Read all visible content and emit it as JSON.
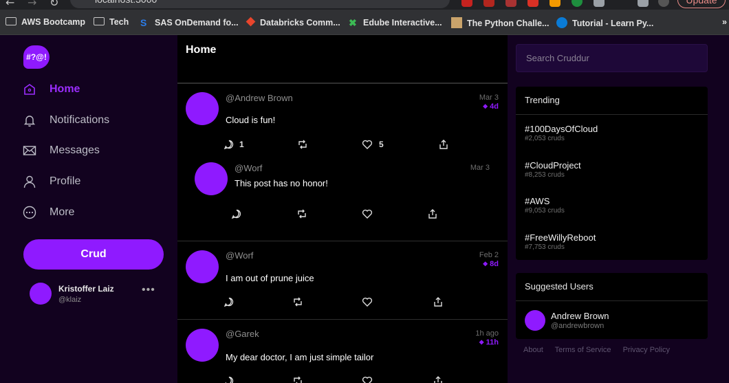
{
  "browser": {
    "url": "localhost:3000",
    "update_label": "Update",
    "bookmarks": [
      {
        "label": "AWS Bootcamp",
        "icon": "folder-icon"
      },
      {
        "label": "Tech",
        "icon": "folder-icon"
      },
      {
        "label": "SAS OnDemand fo...",
        "icon": "sas-icon"
      },
      {
        "label": "Databricks Comm...",
        "icon": "databricks-icon"
      },
      {
        "label": "Edube Interactive...",
        "icon": "edube-icon"
      },
      {
        "label": "The Python Challe...",
        "icon": "python-challenge-icon"
      },
      {
        "label": "Tutorial - Learn Py...",
        "icon": "tutorial-icon"
      }
    ],
    "overflow_label": "»"
  },
  "brand": {
    "logo_text": "#?@!",
    "accent": "#8f1aff",
    "sidebar_bg": "#12021f"
  },
  "sidebar": {
    "items": [
      {
        "label": "Home",
        "icon": "home-icon",
        "active": true
      },
      {
        "label": "Notifications",
        "icon": "bell-icon"
      },
      {
        "label": "Messages",
        "icon": "envelope-icon"
      },
      {
        "label": "Profile",
        "icon": "user-icon"
      },
      {
        "label": "More",
        "icon": "ellipsis-circle-icon"
      }
    ],
    "crud_label": "Crud",
    "profile": {
      "name": "Kristoffer Laiz",
      "handle": "@klaiz",
      "more": "•••"
    }
  },
  "feed": {
    "title": "Home",
    "activities": [
      {
        "handle": "@Andrew Brown",
        "message": "Cloud is fun!",
        "date": "Mar 3",
        "expires": "4d",
        "replies": "1",
        "reposts": "",
        "likes": "5"
      },
      {
        "handle": "@Worf",
        "message": "This post has no honor!",
        "date": "Mar 3",
        "expires": "",
        "replies": "",
        "reposts": "",
        "likes": ""
      },
      {
        "handle": "@Worf",
        "message": "I am out of prune juice",
        "date": "Feb 2",
        "expires": "8d",
        "replies": "",
        "reposts": "",
        "likes": ""
      },
      {
        "handle": "@Garek",
        "message": "My dear doctor, I am just simple tailor",
        "date": "1h ago",
        "expires": "11h",
        "replies": "",
        "reposts": "",
        "likes": ""
      }
    ]
  },
  "search": {
    "placeholder": "Search Cruddur"
  },
  "trending": {
    "title": "Trending",
    "items": [
      {
        "tag": "#100DaysOfCloud",
        "count": "#2,053 cruds"
      },
      {
        "tag": "#CloudProject",
        "count": "#8,253 cruds"
      },
      {
        "tag": "#AWS",
        "count": "#9,053 cruds"
      },
      {
        "tag": "#FreeWillyReboot",
        "count": "#7,753 cruds"
      }
    ]
  },
  "suggested": {
    "title": "Suggested Users",
    "users": [
      {
        "name": "Andrew Brown",
        "handle": "@andrewbrown"
      }
    ]
  },
  "footer": {
    "links": [
      "About",
      "Terms of Service",
      "Privacy Policy"
    ]
  }
}
